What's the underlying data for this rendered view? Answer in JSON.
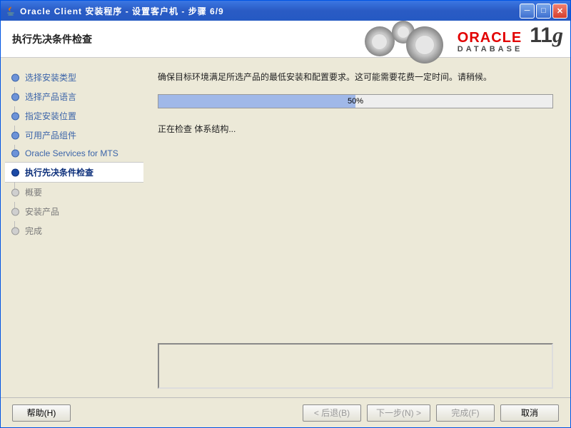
{
  "window": {
    "title": "Oracle Client 安装程序 - 设置客户机 - 步骤 6/9"
  },
  "header": {
    "title": "执行先决条件检查",
    "brand_top": "ORACLE",
    "brand_bottom": "DATABASE",
    "version": "11",
    "version_suffix": "g"
  },
  "steps": [
    {
      "label": "选择安装类型",
      "state": "done"
    },
    {
      "label": "选择产品语言",
      "state": "done"
    },
    {
      "label": "指定安装位置",
      "state": "done"
    },
    {
      "label": "可用产品组件",
      "state": "done"
    },
    {
      "label": "Oracle Services for MTS",
      "state": "done"
    },
    {
      "label": "执行先决条件检查",
      "state": "active"
    },
    {
      "label": "概要",
      "state": "pending"
    },
    {
      "label": "安装产品",
      "state": "pending"
    },
    {
      "label": "完成",
      "state": "pending"
    }
  ],
  "main": {
    "instruction": "确保目标环境满足所选产品的最低安装和配置要求。这可能需要花费一定时间。请稍候。",
    "progress_percent": 50,
    "progress_label": "50%",
    "status": "正在检查 体系结构..."
  },
  "buttons": {
    "help": "帮助(H)",
    "back": "< 后退(B)",
    "next": "下一步(N) >",
    "finish": "完成(F)",
    "cancel": "取消"
  }
}
